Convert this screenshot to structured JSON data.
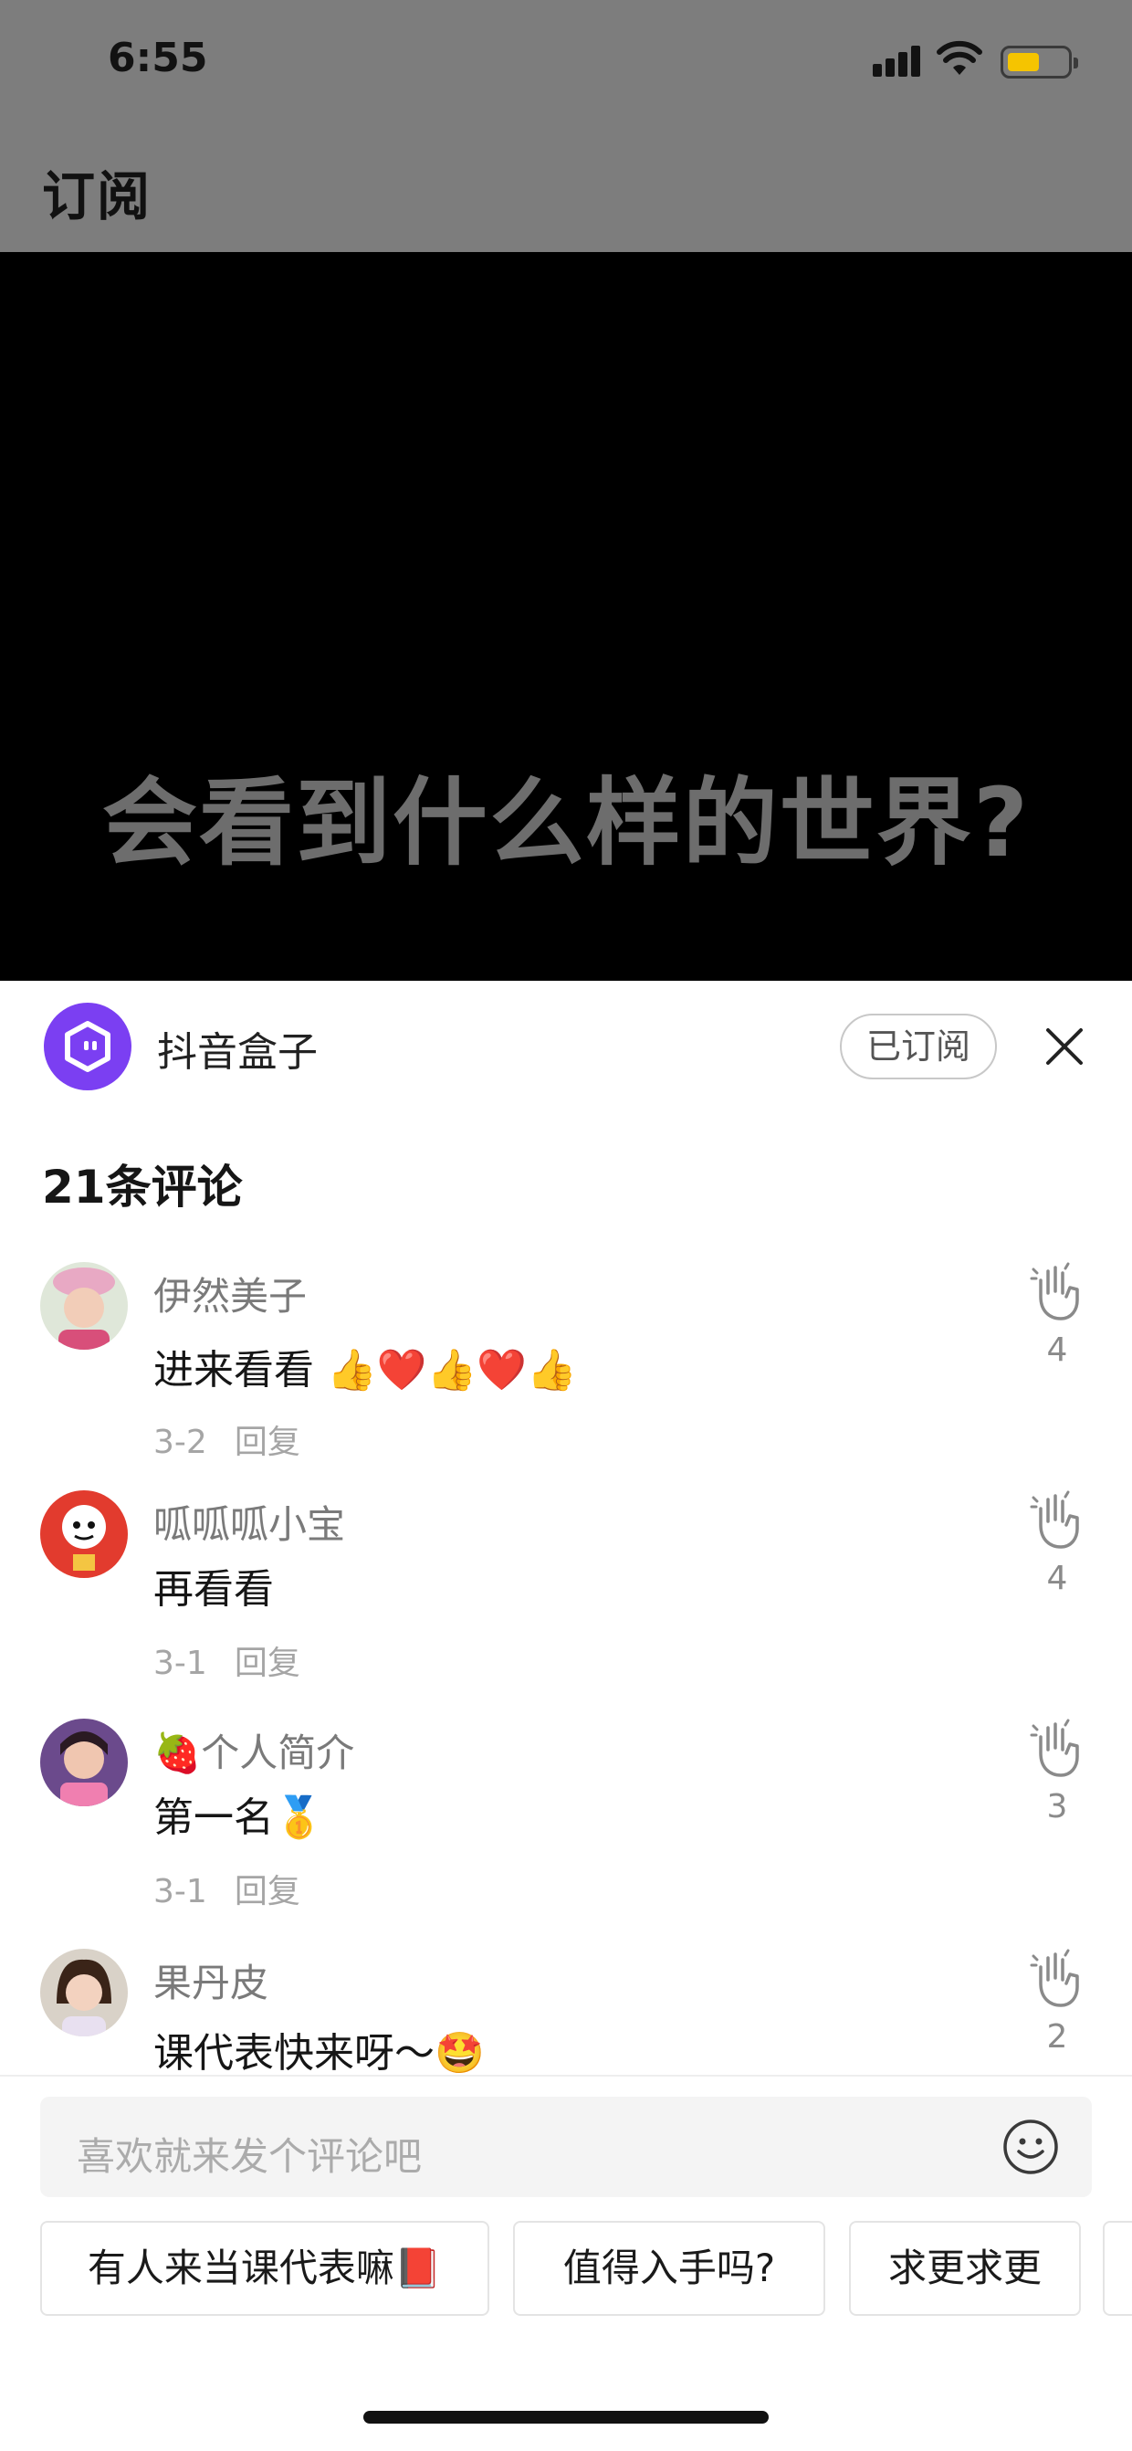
{
  "status_bar": {
    "time": "6:55"
  },
  "header": {
    "title": "订阅"
  },
  "video": {
    "caption": "会看到什么样的世界?"
  },
  "channel": {
    "name": "抖音盒子",
    "subscribed_label": "已订阅"
  },
  "comments_header": {
    "count_label": "21条评论"
  },
  "comments": [
    {
      "user": "伊然美子",
      "text": "进来看看 👍❤️👍❤️👍",
      "date": "3-2",
      "reply_label": "回复",
      "likes": "4"
    },
    {
      "user": "呱呱呱小宝",
      "text": "再看看",
      "date": "3-1",
      "reply_label": "回复",
      "likes": "4"
    },
    {
      "user": "🍓个人简介",
      "text": "第一名🥇",
      "date": "3-1",
      "reply_label": "回复",
      "likes": "3"
    },
    {
      "user": "果丹皮",
      "text": "课代表快来呀～🤩",
      "date": "",
      "reply_label": "",
      "likes": "2"
    }
  ],
  "input": {
    "placeholder": "喜欢就来发个评论吧"
  },
  "quick_replies": [
    "有人来当课代表嘛📕",
    "值得入手吗?",
    "求更求更"
  ],
  "colors": {
    "brand": "#7b3ff2",
    "battery": "#f5c400"
  },
  "icons": [
    "signal-icon",
    "wifi-icon",
    "battery-icon",
    "close-icon",
    "like-hand-icon",
    "emoji-icon"
  ]
}
